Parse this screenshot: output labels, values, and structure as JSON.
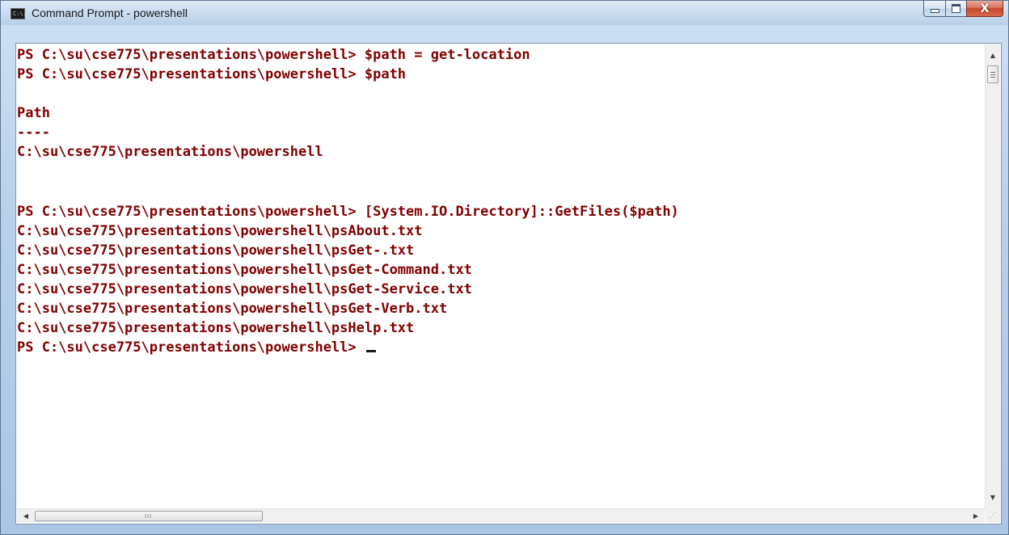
{
  "window": {
    "title": "Command Prompt - powershell",
    "icon_label": "C:\\.",
    "icon": "console-icon",
    "buttons": {
      "minimize_icon": "minimize-icon",
      "maximize_icon": "maximize-icon",
      "close_icon": "close-icon",
      "close_glyph": "X"
    }
  },
  "console": {
    "text_color": "#800000",
    "background": "#ffffff",
    "lines": [
      "PS C:\\su\\cse775\\presentations\\powershell> $path = get-location",
      "PS C:\\su\\cse775\\presentations\\powershell> $path",
      "",
      "Path",
      "----",
      "C:\\su\\cse775\\presentations\\powershell",
      "",
      "",
      "PS C:\\su\\cse775\\presentations\\powershell> [System.IO.Directory]::GetFiles($path)",
      "C:\\su\\cse775\\presentations\\powershell\\psAbout.txt",
      "C:\\su\\cse775\\presentations\\powershell\\psGet-.txt",
      "C:\\su\\cse775\\presentations\\powershell\\psGet-Command.txt",
      "C:\\su\\cse775\\presentations\\powershell\\psGet-Service.txt",
      "C:\\su\\cse775\\presentations\\powershell\\psGet-Verb.txt",
      "C:\\su\\cse775\\presentations\\powershell\\psHelp.txt"
    ],
    "prompt": "PS C:\\su\\cse775\\presentations\\powershell> "
  },
  "scrollbars": {
    "vertical": {
      "up_arrow": "▲",
      "down_arrow": "▼"
    },
    "horizontal": {
      "left_arrow": "◀",
      "right_arrow": "▶",
      "grip": "III"
    },
    "resize_grip": "⋰"
  }
}
